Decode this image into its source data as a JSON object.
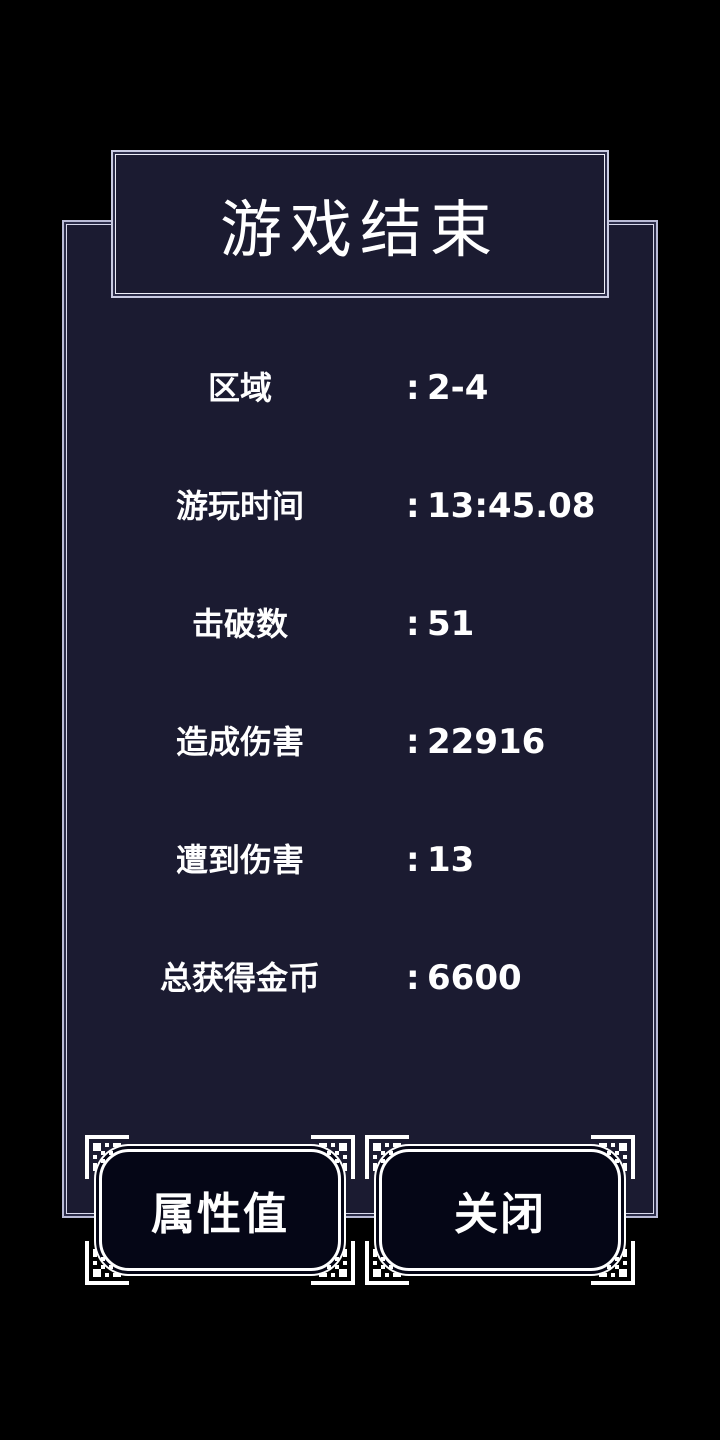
{
  "title": "游戏结束",
  "stats": [
    {
      "label": "区域",
      "colon": ":",
      "value": "2-4"
    },
    {
      "label": "游玩时间",
      "colon": ":",
      "value": "13:45.08"
    },
    {
      "label": "击破数",
      "colon": ":",
      "value": "51"
    },
    {
      "label": "造成伤害",
      "colon": ":",
      "value": "22916"
    },
    {
      "label": "遭到伤害",
      "colon": ":",
      "value": "13"
    },
    {
      "label": "总获得金币",
      "colon": ":",
      "value": "6600"
    }
  ],
  "buttons": {
    "attributes_label": "属性值",
    "close_label": "关闭"
  },
  "colors": {
    "background": "#000000",
    "panel": "#1b1b31",
    "border": "#c9cbe2",
    "button_fill": "#050616",
    "text": "#ffffff"
  }
}
